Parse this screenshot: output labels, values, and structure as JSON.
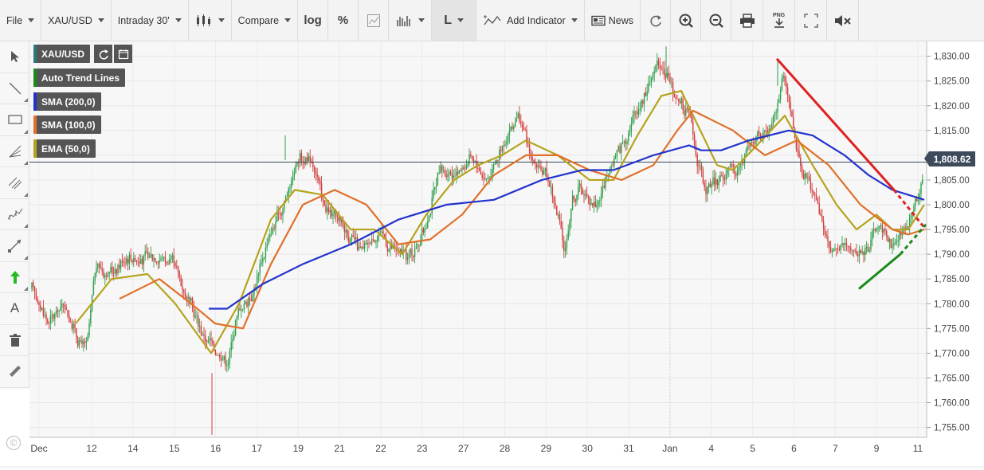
{
  "toolbar": {
    "file": "File",
    "symbol": "XAU/USD",
    "interval": "Intraday 30'",
    "compare": "Compare",
    "log": "log",
    "percent": "%",
    "line_type": "L",
    "add_indicator": "Add Indicator",
    "news": "News",
    "png": "PNG"
  },
  "left_tools": [
    "pointer-icon",
    "line-icon",
    "rectangle-icon",
    "fan-icon",
    "channel-icon",
    "pitchfork-icon",
    "ray-icon",
    "arrow-up-icon",
    "text-icon",
    "trash-icon",
    "ruler-icon"
  ],
  "legend": {
    "symbol": "XAU/USD",
    "items": [
      {
        "label": "Auto Trend Lines",
        "color": "#1a8a1a"
      },
      {
        "label": "SMA (200,0)",
        "color": "#2233cc"
      },
      {
        "label": "SMA (100,0)",
        "color": "#e0702a"
      },
      {
        "label": "EMA (50,0)",
        "color": "#b5a31e"
      }
    ]
  },
  "colors": {
    "up": "#2e9e4a",
    "down": "#d23c3c",
    "sma200": "#2233cc",
    "sma100": "#e0702a",
    "ema50": "#b5a31e",
    "trend_res": "#e02020",
    "trend_sup": "#1a8a1a",
    "last_line": "#3d4a5a"
  },
  "chart_data": {
    "type": "candlestick",
    "ylim": [
      1753,
      1833
    ],
    "y_ticks": [
      1755,
      1760,
      1765,
      1770,
      1775,
      1780,
      1785,
      1790,
      1795,
      1800,
      1805,
      1810,
      1815,
      1820,
      1825,
      1830
    ],
    "x_tick_labels": [
      "Dec",
      "12",
      "14",
      "15",
      "16",
      "17",
      "19",
      "21",
      "22",
      "23",
      "27",
      "28",
      "29",
      "30",
      "31",
      "Jan",
      "4",
      "5",
      "6",
      "7",
      "9",
      "11"
    ],
    "last_price": 1808.62,
    "last_price_label": "1,808.62",
    "price_anchors": [
      [
        0,
        1783
      ],
      [
        2,
        1776
      ],
      [
        4,
        1780
      ],
      [
        6,
        1772
      ],
      [
        7,
        1771
      ],
      [
        8,
        1788
      ],
      [
        10,
        1786
      ],
      [
        12,
        1790
      ],
      [
        14,
        1789
      ],
      [
        16,
        1790
      ],
      [
        18,
        1788
      ],
      [
        20,
        1780
      ],
      [
        22,
        1773
      ],
      [
        24,
        1770
      ],
      [
        25,
        1768
      ],
      [
        26,
        1778
      ],
      [
        28,
        1782
      ],
      [
        30,
        1793
      ],
      [
        32,
        1800
      ],
      [
        34,
        1810
      ],
      [
        36,
        1808
      ],
      [
        37,
        1800
      ],
      [
        38,
        1798
      ],
      [
        40,
        1795
      ],
      [
        42,
        1790
      ],
      [
        44,
        1795
      ],
      [
        46,
        1791
      ],
      [
        48,
        1789
      ],
      [
        50,
        1795
      ],
      [
        52,
        1807
      ],
      [
        54,
        1806
      ],
      [
        56,
        1810
      ],
      [
        58,
        1805
      ],
      [
        60,
        1812
      ],
      [
        62,
        1818
      ],
      [
        64,
        1808
      ],
      [
        66,
        1805
      ],
      [
        67,
        1798
      ],
      [
        68,
        1790
      ],
      [
        69,
        1802
      ],
      [
        70,
        1803
      ],
      [
        72,
        1800
      ],
      [
        74,
        1808
      ],
      [
        76,
        1815
      ],
      [
        78,
        1822
      ],
      [
        80,
        1830
      ],
      [
        82,
        1822
      ],
      [
        84,
        1818
      ],
      [
        85,
        1808
      ],
      [
        86,
        1802
      ],
      [
        88,
        1806
      ],
      [
        90,
        1807
      ],
      [
        92,
        1813
      ],
      [
        94,
        1815
      ],
      [
        96,
        1826
      ],
      [
        98,
        1808
      ],
      [
        100,
        1802
      ],
      [
        102,
        1790
      ],
      [
        104,
        1792
      ],
      [
        106,
        1790
      ],
      [
        108,
        1796
      ],
      [
        110,
        1792
      ],
      [
        112,
        1796
      ],
      [
        114,
        1808
      ]
    ],
    "sma200": [
      [
        262,
        1779
      ],
      [
        285,
        1779
      ],
      [
        330,
        1784
      ],
      [
        380,
        1788
      ],
      [
        440,
        1792
      ],
      [
        500,
        1797
      ],
      [
        560,
        1800
      ],
      [
        620,
        1801
      ],
      [
        680,
        1805
      ],
      [
        730,
        1807
      ],
      [
        770,
        1807
      ],
      [
        820,
        1810
      ],
      [
        865,
        1812
      ],
      [
        880,
        1811
      ],
      [
        905,
        1811
      ],
      [
        940,
        1813
      ],
      [
        990,
        1815
      ],
      [
        1020,
        1814
      ],
      [
        1060,
        1810
      ],
      [
        1090,
        1806
      ],
      [
        1120,
        1803
      ],
      [
        1160,
        1801
      ]
    ],
    "sma100": [
      [
        150,
        1781
      ],
      [
        200,
        1785
      ],
      [
        240,
        1780
      ],
      [
        270,
        1776
      ],
      [
        305,
        1775
      ],
      [
        340,
        1788
      ],
      [
        380,
        1800
      ],
      [
        420,
        1803
      ],
      [
        460,
        1800
      ],
      [
        500,
        1792
      ],
      [
        540,
        1793
      ],
      [
        580,
        1798
      ],
      [
        620,
        1806
      ],
      [
        660,
        1810
      ],
      [
        700,
        1810
      ],
      [
        740,
        1807
      ],
      [
        780,
        1805
      ],
      [
        820,
        1808
      ],
      [
        850,
        1815
      ],
      [
        870,
        1819
      ],
      [
        920,
        1815
      ],
      [
        960,
        1810
      ],
      [
        1000,
        1813
      ],
      [
        1040,
        1808
      ],
      [
        1080,
        1800
      ],
      [
        1120,
        1795
      ],
      [
        1140,
        1794
      ],
      [
        1160,
        1795
      ]
    ],
    "ema50": [
      [
        95,
        1776
      ],
      [
        140,
        1785
      ],
      [
        185,
        1786
      ],
      [
        220,
        1780
      ],
      [
        265,
        1770
      ],
      [
        300,
        1780
      ],
      [
        340,
        1797
      ],
      [
        370,
        1803
      ],
      [
        405,
        1802
      ],
      [
        440,
        1795
      ],
      [
        470,
        1795
      ],
      [
        505,
        1790
      ],
      [
        535,
        1798
      ],
      [
        570,
        1805
      ],
      [
        600,
        1808
      ],
      [
        630,
        1810
      ],
      [
        660,
        1813
      ],
      [
        700,
        1810
      ],
      [
        740,
        1805
      ],
      [
        770,
        1805
      ],
      [
        800,
        1814
      ],
      [
        830,
        1822
      ],
      [
        855,
        1823
      ],
      [
        870,
        1818
      ],
      [
        900,
        1808
      ],
      [
        920,
        1807
      ],
      [
        950,
        1812
      ],
      [
        985,
        1818
      ],
      [
        1020,
        1808
      ],
      [
        1050,
        1800
      ],
      [
        1075,
        1795
      ],
      [
        1100,
        1798
      ],
      [
        1120,
        1795
      ],
      [
        1140,
        1795
      ],
      [
        1160,
        1800
      ]
    ],
    "trend_resistance": [
      [
        975,
        1829.5
      ],
      [
        1122,
        1803
      ],
      [
        1162,
        1795
      ]
    ],
    "trend_support": [
      [
        1078,
        1783
      ],
      [
        1130,
        1790
      ],
      [
        1162,
        1796
      ]
    ]
  }
}
